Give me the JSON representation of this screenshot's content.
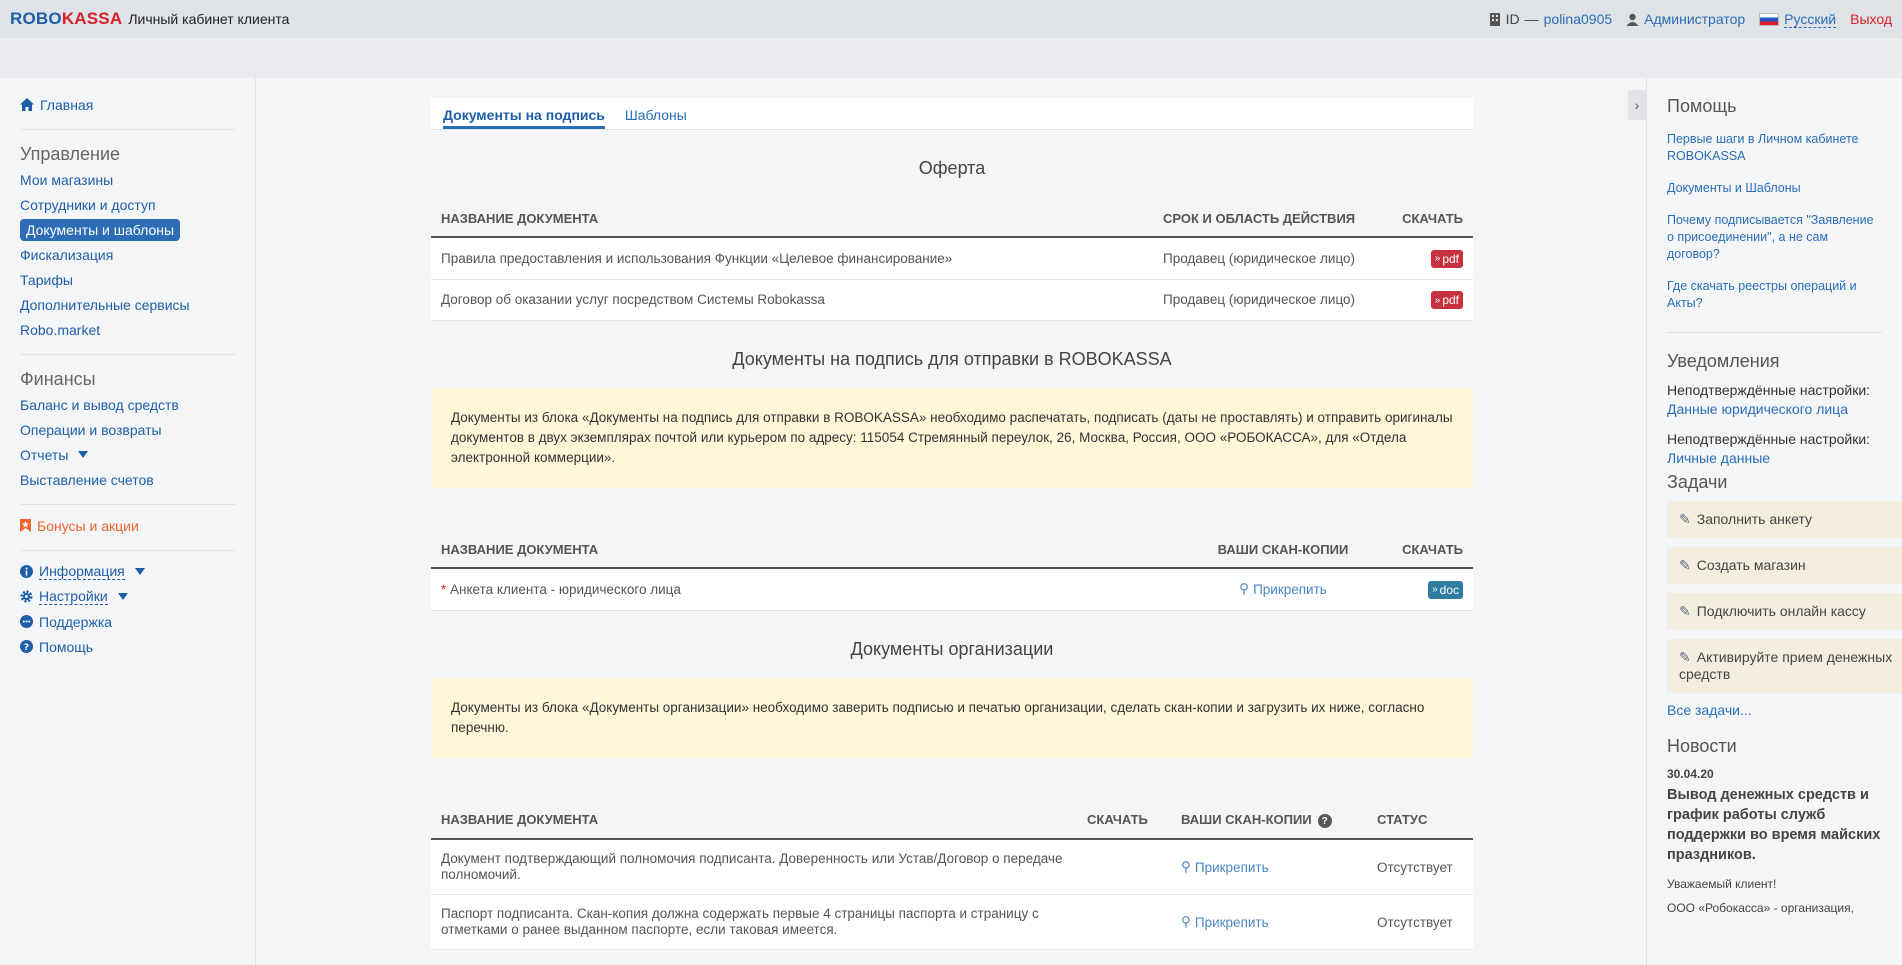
{
  "header": {
    "logo_robo": "ROBO",
    "logo_kassa": "KASSA",
    "cabinet_title": "Личный кабинет клиента",
    "id_label": "ID",
    "id_dash": "—",
    "user_login": "polina0905",
    "role": "Администратор",
    "language": "Русский",
    "logout": "Выход"
  },
  "sidebar": {
    "home": "Главная",
    "management_title": "Управление",
    "management_items": [
      "Мои магазины",
      "Сотрудники и доступ",
      "Документы и шаблоны",
      "Фискализация",
      "Тарифы",
      "Дополнительные сервисы",
      "Robo.market"
    ],
    "finance_title": "Финансы",
    "finance_items": [
      "Баланс и вывод средств",
      "Операции и возвраты",
      "Отчеты",
      "Выставление счетов"
    ],
    "bonus": "Бонусы и акции",
    "info": "Информация",
    "settings": "Настройки",
    "support": "Поддержка",
    "help": "Помощь"
  },
  "tabs": [
    "Документы на подпись",
    "Шаблоны"
  ],
  "offer": {
    "title": "Оферта",
    "headers": [
      "НАЗВАНИЕ ДОКУМЕНТА",
      "СРОК И ОБЛАСТЬ ДЕЙСТВИЯ",
      "СКАЧАТЬ"
    ],
    "rows": [
      {
        "name": "Правила предоставления и использования Функции «Целевое финансирование»",
        "scope": "Продавец (юридическое лицо)",
        "file": "pdf"
      },
      {
        "name": "Договор об оказании услуг посредством Системы Robokassa",
        "scope": "Продавец (юридическое лицо)",
        "file": "pdf"
      }
    ]
  },
  "sign_docs": {
    "title": "Документы на подпись для отправки в ROBOKASSA",
    "notice": "Документы из блока «Документы на подпись для отправки в ROBOKASSA» необходимо распечатать, подписать (даты не проставлять) и отправить оригиналы документов в двух экземплярах почтой или курьером по адресу: 115054 Стремянный переулок, 26, Москва, Россия, ООО «РОБОКАССА», для «Отдела электронной коммерции».",
    "headers": [
      "НАЗВАНИЕ ДОКУМЕНТА",
      "ВАШИ СКАН-КОПИИ",
      "СКАЧАТЬ"
    ],
    "rows": [
      {
        "required": "*",
        "name": "Анкета клиента - юридического лица",
        "attach": "Прикрепить",
        "file": "doc"
      }
    ]
  },
  "org_docs": {
    "title": "Документы организации",
    "notice": "Документы из блока «Документы организации» необходимо заверить подписью и печатью организации, сделать скан-копии и загрузить их ниже, согласно перечню.",
    "headers": [
      "НАЗВАНИЕ ДОКУМЕНТА",
      "СКАЧАТЬ",
      "ВАШИ СКАН-КОПИИ",
      "СТАТУС"
    ],
    "rows": [
      {
        "name": "Документ подтверждающий полномочия подписанта. Доверенность или Устав/Договор о передаче полномочий.",
        "attach": "Прикрепить",
        "status": "Отсутствует"
      },
      {
        "name": "Паспорт подписанта. Скан-копия должна содержать первые 4 страницы паспорта и страницу с отметками о ранее выданном паспорте, если таковая имеется.",
        "attach": "Прикрепить",
        "status": "Отсутствует"
      }
    ]
  },
  "right_panel": {
    "help_title": "Помощь",
    "help_links": [
      "Первые шаги в Личном кабинете ROBOKASSA",
      "Документы и Шаблоны",
      "Почему подписывается \"Заявление о присоединении\", а не сам договор?",
      "Где скачать реестры операций и Акты?"
    ],
    "notifications_title": "Уведомления",
    "notifications": [
      {
        "label": "Неподтверждённые настройки:",
        "link": "Данные юридического лица"
      },
      {
        "label": "Неподтверждённые настройки:",
        "link": "Личные данные"
      }
    ],
    "tasks_title": "Задачи",
    "tasks": [
      "Заполнить анкету",
      "Создать магазин",
      "Подключить онлайн кассу",
      "Активируйте прием денежных средств"
    ],
    "all_tasks": "Все задачи...",
    "news_title": "Новости",
    "news_date": "30.04.20",
    "news_headline": "Вывод денежных средств и график работы служб поддержки во время майских праздников.",
    "news_greeting": "Уважаемый клиент!",
    "news_text": "ООО «Робокасса» - организация,"
  }
}
